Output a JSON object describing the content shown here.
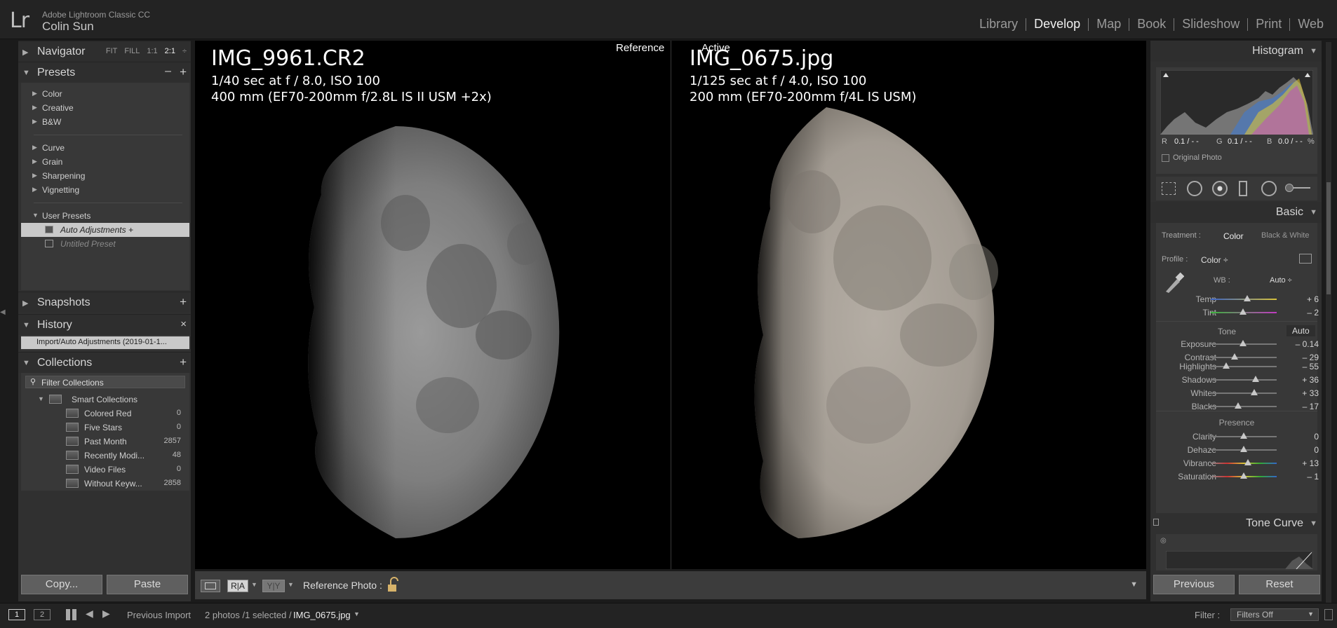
{
  "app": {
    "logo": "Lr",
    "name": "Adobe Lightroom Classic CC",
    "user": "Colin Sun"
  },
  "modules": [
    {
      "label": "Library",
      "active": false
    },
    {
      "label": "Develop",
      "active": true
    },
    {
      "label": "Map",
      "active": false
    },
    {
      "label": "Book",
      "active": false
    },
    {
      "label": "Slideshow",
      "active": false
    },
    {
      "label": "Print",
      "active": false
    },
    {
      "label": "Web",
      "active": false
    }
  ],
  "navigator": {
    "title": "Navigator",
    "zoom": [
      "FIT",
      "FILL",
      "1:1",
      "2:1"
    ],
    "zoom_arrow": "÷"
  },
  "presets": {
    "title": "Presets",
    "minus": "–",
    "plus": "+",
    "groups1": [
      "Color",
      "Creative",
      "B&W"
    ],
    "groups2": [
      "Curve",
      "Grain",
      "Sharpening",
      "Vignetting"
    ],
    "user_presets": "User Presets",
    "items": [
      "Auto Adjustments +",
      "Untitled Preset"
    ]
  },
  "snapshots": {
    "title": "Snapshots",
    "plus": "+"
  },
  "history": {
    "title": "History",
    "close": "×",
    "entry": "Import/Auto Adjustments (2019-01-1..."
  },
  "collections": {
    "title": "Collections",
    "plus": "+",
    "filter": "Filter Collections",
    "smart": "Smart Collections",
    "items": [
      {
        "name": "Colored Red",
        "count": "0"
      },
      {
        "name": "Five Stars",
        "count": "0"
      },
      {
        "name": "Past Month",
        "count": "2857"
      },
      {
        "name": "Recently Modi...",
        "count": "48"
      },
      {
        "name": "Video Files",
        "count": "0"
      },
      {
        "name": "Without Keyw...",
        "count": "2858"
      }
    ]
  },
  "left_buttons": {
    "copy": "Copy...",
    "paste": "Paste"
  },
  "reference": {
    "tag": "Reference",
    "filename": "IMG_9961.CR2",
    "exposure": "1/40 sec at f / 8.0, ISO 100",
    "lens": "400 mm (EF70-200mm f/2.8L IS II USM +2x)"
  },
  "active": {
    "tag": "Active",
    "filename": "IMG_0675.jpg",
    "exposure": "1/125 sec at f / 4.0, ISO 100",
    "lens": "200 mm (EF70-200mm f/4L IS USM)"
  },
  "toolbar": {
    "ra": "R|A",
    "yy": "Y|Y",
    "ref_label": "Reference Photo :",
    "dropdown": "▼"
  },
  "histogram": {
    "title": "Histogram",
    "r_label": "R",
    "r_val": "0.1 / - -",
    "g_label": "G",
    "g_val": "0.1 / - -",
    "b_label": "B",
    "b_val": "0.0 / - -",
    "pct": "%",
    "original": "Original Photo"
  },
  "basic": {
    "title": "Basic",
    "treatment_label": "Treatment :",
    "treatment_color": "Color",
    "treatment_bw": "Black & White",
    "profile_label": "Profile :",
    "profile_value": "Color ÷",
    "wb_label": "WB :",
    "wb_value": "Auto ÷",
    "tone_label": "Tone",
    "tone_auto": "Auto",
    "presence_label": "Presence",
    "sliders_wb": [
      {
        "name": "Temp",
        "value": "+ 6",
        "pos": 0.55
      },
      {
        "name": "Tint",
        "value": "– 2",
        "pos": 0.49
      }
    ],
    "sliders_tone1": [
      {
        "name": "Exposure",
        "value": "– 0.14",
        "pos": 0.49
      },
      {
        "name": "Contrast",
        "value": "– 29",
        "pos": 0.36
      }
    ],
    "sliders_tone2": [
      {
        "name": "Highlights",
        "value": "– 55",
        "pos": 0.23
      },
      {
        "name": "Shadows",
        "value": "+ 36",
        "pos": 0.68
      },
      {
        "name": "Whites",
        "value": "+ 33",
        "pos": 0.66
      },
      {
        "name": "Blacks",
        "value": "– 17",
        "pos": 0.42
      }
    ],
    "sliders_presence": [
      {
        "name": "Clarity",
        "value": "0",
        "pos": 0.5
      },
      {
        "name": "Dehaze",
        "value": "0",
        "pos": 0.5
      },
      {
        "name": "Vibrance",
        "value": "+ 13",
        "pos": 0.56
      },
      {
        "name": "Saturation",
        "value": "– 1",
        "pos": 0.5
      }
    ]
  },
  "tone_curve": {
    "title": "Tone Curve"
  },
  "right_buttons": {
    "previous": "Previous",
    "reset": "Reset"
  },
  "filmstrip": {
    "view1": "1",
    "view2": "2",
    "source": "Previous Import",
    "count": "2 photos /1 selected /",
    "selected": "IMG_0675.jpg",
    "filter_label": "Filter :",
    "filter_value": "Filters Off"
  },
  "colors": {
    "bg": "#1b1b1b",
    "panel": "#303030",
    "accent_text": "#f0f0f0"
  }
}
